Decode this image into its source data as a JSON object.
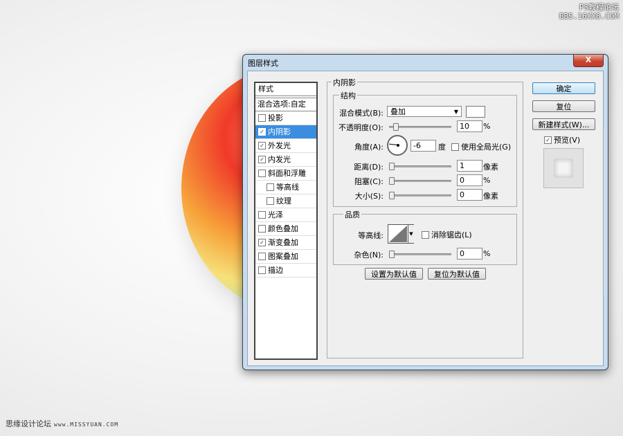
{
  "watermark": {
    "line1": "PS教程论坛",
    "line2": "BBS.16XX8.COM"
  },
  "footer": {
    "text": "思缘设计论坛",
    "url": "www.MISSYUAN.COM"
  },
  "dialog": {
    "title": "图层样式",
    "close_glyph": "X",
    "styles_panel": {
      "header": "样式",
      "blend_options": "混合选项:自定",
      "items": [
        {
          "label": "投影",
          "checked": false,
          "selected": false,
          "sub": false
        },
        {
          "label": "内阴影",
          "checked": true,
          "selected": true,
          "sub": false
        },
        {
          "label": "外发光",
          "checked": true,
          "selected": false,
          "sub": false
        },
        {
          "label": "内发光",
          "checked": true,
          "selected": false,
          "sub": false
        },
        {
          "label": "斜面和浮雕",
          "checked": false,
          "selected": false,
          "sub": false
        },
        {
          "label": "等高线",
          "checked": false,
          "selected": false,
          "sub": true
        },
        {
          "label": "纹理",
          "checked": false,
          "selected": false,
          "sub": true
        },
        {
          "label": "光泽",
          "checked": false,
          "selected": false,
          "sub": false
        },
        {
          "label": "颜色叠加",
          "checked": false,
          "selected": false,
          "sub": false
        },
        {
          "label": "渐变叠加",
          "checked": true,
          "selected": false,
          "sub": false
        },
        {
          "label": "图案叠加",
          "checked": false,
          "selected": false,
          "sub": false
        },
        {
          "label": "描边",
          "checked": false,
          "selected": false,
          "sub": false
        }
      ]
    },
    "inner_shadow": {
      "group_title": "内阴影",
      "structure": {
        "title": "结构",
        "blend_mode_label": "混合模式(B):",
        "blend_mode_value": "叠加",
        "blend_color": "#ffffff",
        "opacity_label": "不透明度(O):",
        "opacity_value": "10",
        "opacity_unit": "%",
        "angle_label": "角度(A):",
        "angle_value": "-6",
        "angle_unit": "度",
        "global_light_label": "使用全局光(G)",
        "global_light_checked": false,
        "distance_label": "距离(D):",
        "distance_value": "1",
        "distance_unit": "像素",
        "choke_label": "阻塞(C):",
        "choke_value": "0",
        "choke_unit": "%",
        "size_label": "大小(S):",
        "size_value": "0",
        "size_unit": "像素"
      },
      "quality": {
        "title": "品质",
        "contour_label": "等高线:",
        "anti_alias_label": "消除锯齿(L)",
        "anti_alias_checked": false,
        "noise_label": "杂色(N):",
        "noise_value": "0",
        "noise_unit": "%"
      },
      "make_default": "设置为默认值",
      "reset_default": "复位为默认值"
    },
    "buttons": {
      "ok": "确定",
      "reset": "复位",
      "new_style": "新建样式(W)...",
      "preview_label": "预览(V)",
      "preview_checked": true
    }
  }
}
